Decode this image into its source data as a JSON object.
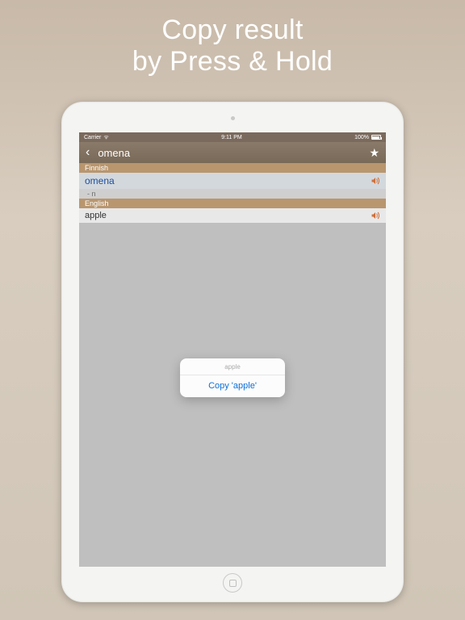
{
  "promo": {
    "line1": "Copy result",
    "line2": "by Press & Hold"
  },
  "status": {
    "carrier": "Carrier",
    "wifi": "􀙇",
    "time": "9:11 PM",
    "battery": "100%"
  },
  "nav": {
    "title": "omena"
  },
  "sections": {
    "finnish_label": "Finnish",
    "english_label": "English"
  },
  "entry": {
    "source_word": "omena",
    "pos": "- n",
    "translation": "apple"
  },
  "popup": {
    "selected": "apple",
    "action": "Copy 'apple'"
  }
}
